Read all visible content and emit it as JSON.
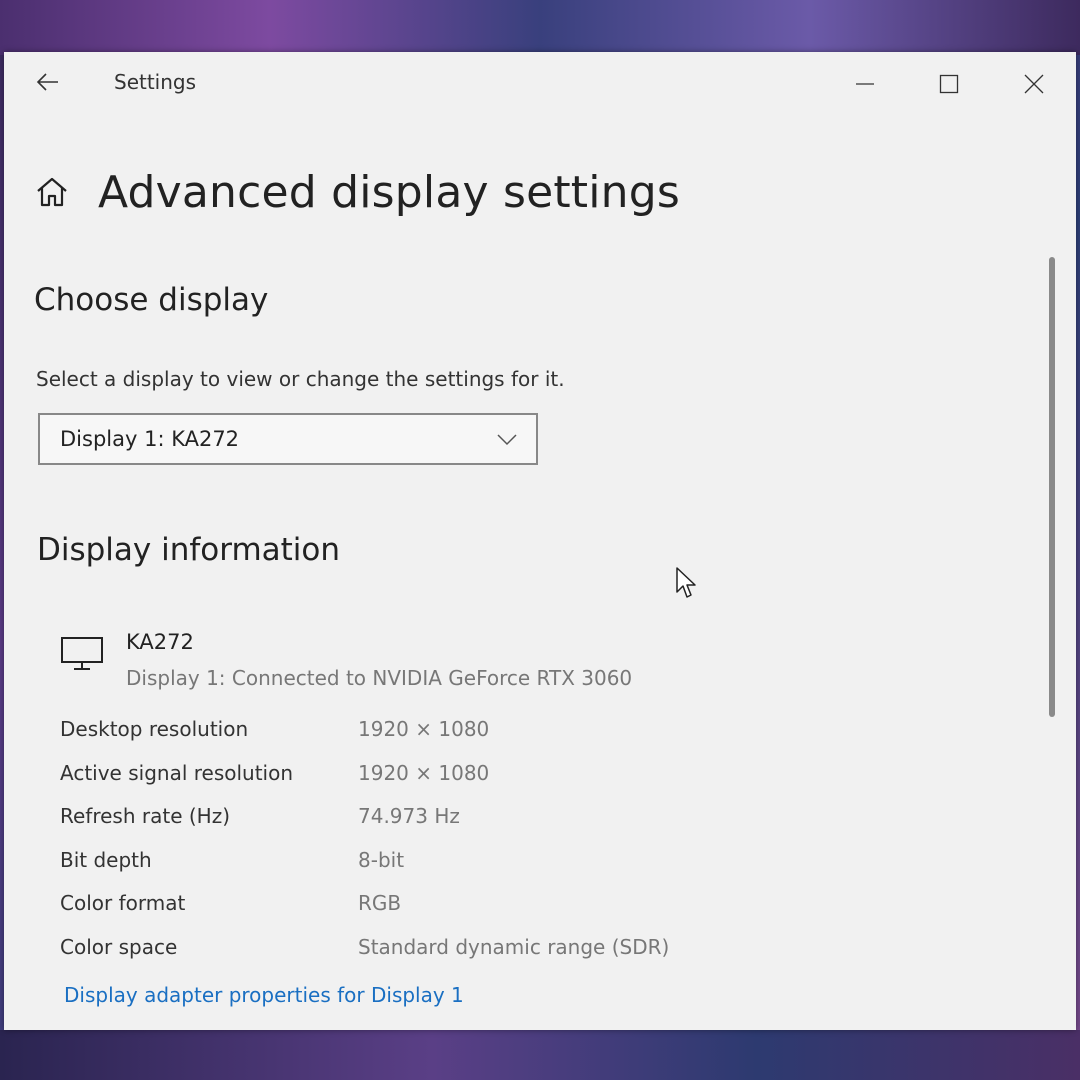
{
  "window": {
    "app_title": "Settings"
  },
  "page": {
    "title": "Advanced display settings"
  },
  "choose_display": {
    "heading": "Choose display",
    "prompt": "Select a display to view or change the settings for it.",
    "selected_display": "Display 1: KA272"
  },
  "display_information": {
    "heading": "Display information",
    "monitor_name": "KA272",
    "monitor_connection": "Display 1: Connected to NVIDIA GeForce RTX 3060",
    "rows": [
      {
        "label": "Desktop resolution",
        "value": "1920 × 1080"
      },
      {
        "label": "Active signal resolution",
        "value": "1920 × 1080"
      },
      {
        "label": "Refresh rate (Hz)",
        "value": "74.973 Hz"
      },
      {
        "label": "Bit depth",
        "value": "8-bit"
      },
      {
        "label": "Color format",
        "value": "RGB"
      },
      {
        "label": "Color space",
        "value": "Standard dynamic range (SDR)"
      }
    ],
    "adapter_link": "Display adapter properties for Display 1"
  },
  "icons": {
    "back": "back-arrow-icon",
    "minimize": "minimize-icon",
    "maximize": "maximize-icon",
    "close": "close-icon",
    "home": "home-icon",
    "dropdown": "chevron-down-icon",
    "monitor": "monitor-icon",
    "cursor": "mouse-cursor-icon"
  },
  "colors": {
    "window_background": "#f1f1f1",
    "link": "#1a6fc2",
    "secondary_text": "#777777"
  }
}
